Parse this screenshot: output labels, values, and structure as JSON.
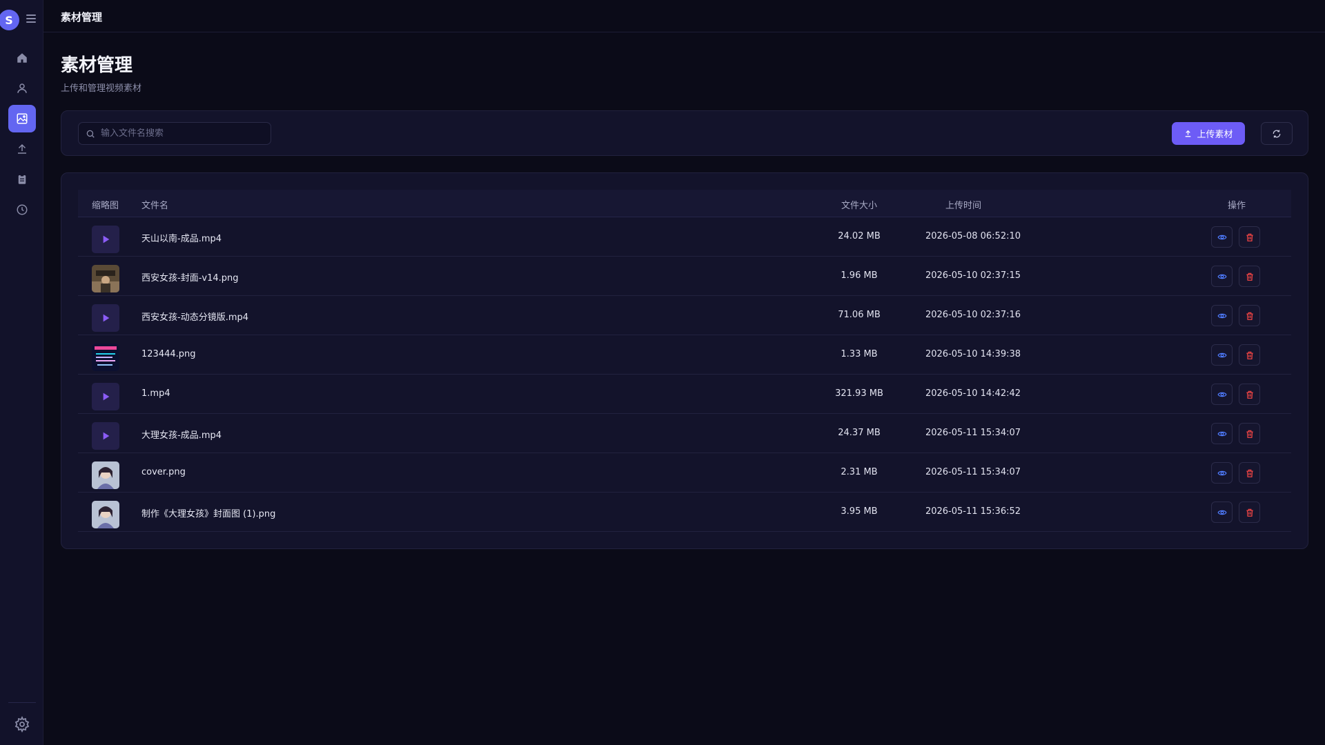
{
  "sidebar": {
    "avatar_letter": "S",
    "nav": [
      "home-icon",
      "user-icon",
      "image-icon",
      "upload-icon",
      "clipboard-icon",
      "clock-icon"
    ],
    "active_index": 2,
    "accent": "#6366f1"
  },
  "topbar": {
    "title": "素材管理"
  },
  "page": {
    "title": "素材管理",
    "subtitle": "上传和管理视频素材"
  },
  "toolbar": {
    "search_placeholder": "输入文件名搜索",
    "upload_label": "上传素材"
  },
  "table": {
    "headers": {
      "thumbnail": "缩略图",
      "filename": "文件名",
      "size": "文件大小",
      "time": "上传时间",
      "actions": "操作"
    },
    "rows": [
      {
        "thumb": "video",
        "name": "天山以南-成品.mp4",
        "size": "24.02 MB",
        "time": "2026-05-08 06:52:10"
      },
      {
        "thumb": "image-photo",
        "name": "西安女孩-封面-v14.png",
        "size": "1.96 MB",
        "time": "2026-05-10 02:37:15"
      },
      {
        "thumb": "video",
        "name": "西安女孩-动态分镜版.mp4",
        "size": "71.06 MB",
        "time": "2026-05-10 02:37:16"
      },
      {
        "thumb": "image-poster",
        "name": "123444.png",
        "size": "1.33 MB",
        "time": "2026-05-10 14:39:38"
      },
      {
        "thumb": "video",
        "name": "1.mp4",
        "size": "321.93 MB",
        "time": "2026-05-10 14:42:42"
      },
      {
        "thumb": "video",
        "name": "大理女孩-成品.mp4",
        "size": "24.37 MB",
        "time": "2026-05-11 15:34:07"
      },
      {
        "thumb": "image-portrait",
        "name": "cover.png",
        "size": "2.31 MB",
        "time": "2026-05-11 15:34:07"
      },
      {
        "thumb": "image-portrait",
        "name": "制作《大理女孩》封面图 (1).png",
        "size": "3.95 MB",
        "time": "2026-05-11 15:36:52"
      }
    ]
  },
  "colors": {
    "play": "#8b5cf6",
    "view": "#4f7cff",
    "delete": "#ef4444"
  }
}
